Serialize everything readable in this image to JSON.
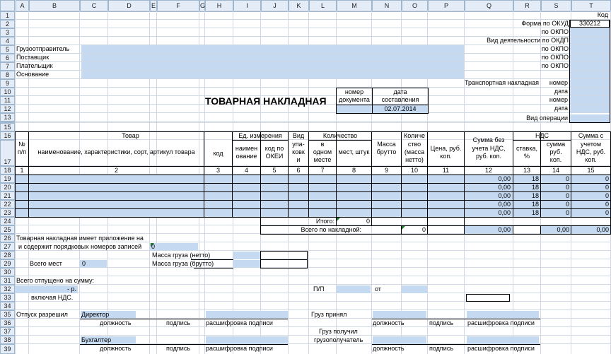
{
  "columns": [
    "A",
    "B",
    "C",
    "D",
    "E",
    "F",
    "G",
    "H",
    "I",
    "J",
    "K",
    "L",
    "M",
    "N",
    "O",
    "P",
    "Q",
    "R",
    "S",
    "T"
  ],
  "rows": [
    "1",
    "2",
    "3",
    "4",
    "5",
    "6",
    "7",
    "8",
    "9",
    "10",
    "11",
    "12",
    "13",
    "14",
    "15",
    "16",
    "17",
    "18",
    "19",
    "20",
    "21",
    "22",
    "23",
    "24",
    "25",
    "26",
    "27",
    "28",
    "29",
    "30",
    "31",
    "32",
    "33",
    "34",
    "35",
    "36",
    "37",
    "38",
    "39"
  ],
  "header": {
    "kod": "Код",
    "okud_label": "Форма по ОКУД",
    "okud_value": "330212",
    "okpo": "по ОКПО",
    "vid_deyat": "Вид деятельности по ОКДП",
    "gruzootpravitel": "Грузоотправитель",
    "postavshik": "Поставщик",
    "platelshik": "Плательщик",
    "osnovanie": "Основание",
    "transport": "Транспортная накладная",
    "nomer": "номер",
    "data": "дата",
    "vid_operacii": "Вид операции",
    "title": "ТОВАРНАЯ НАКЛАДНАЯ",
    "nomer_doc_1": "номер",
    "nomer_doc_2": "документа",
    "data_sost_1": "дата",
    "data_sost_2": "составления",
    "date_value": "02.07.2014"
  },
  "table_head": {
    "np_1": "№",
    "np_2": "п/п",
    "tovar": "Товар",
    "naimen": "наименование, характеристики, сорт, артикул товара",
    "kod": "код",
    "ed_izm": "Ед. измерения",
    "naimen_1": "наимен",
    "naimen_2": "ование",
    "okei_1": "код по",
    "okei_2": "ОКЕИ",
    "vid_1": "Вид",
    "vid_2": "упа-",
    "vid_3": "ковк",
    "vid_4": "и",
    "kolichestvo": "Количество",
    "v_odnom_1": "в",
    "v_odnom_2": "одном",
    "v_odnom_3": "месте",
    "mest": "мест, штук",
    "massa_1": "Масса",
    "massa_2": "брутто",
    "kol_1": "Количе",
    "kol_2": "ство",
    "kol_3": "(масса",
    "kol_4": "нетто)",
    "cena_1": "Цена, руб.",
    "cena_2": "коп.",
    "summa_bez_1": "Сумма без",
    "summa_bez_2": "учета НДС,",
    "summa_bez_3": "руб. коп.",
    "nds": "НДС",
    "stavka_1": "ставка,",
    "stavka_2": "%",
    "summa_1": "сумма",
    "summa_2": "руб.",
    "summa_3": "коп.",
    "summa_s_1": "Сумма с",
    "summa_s_2": "учетом",
    "summa_s_3": "НДС, руб.",
    "summa_s_4": "коп.",
    "nums": [
      "1",
      "2",
      "3",
      "4",
      "5",
      "6",
      "7",
      "8",
      "9",
      "10",
      "11",
      "12",
      "13",
      "14",
      "15"
    ]
  },
  "data_rows": [
    {
      "sum": "0,00",
      "rate": "18",
      "vat": "0",
      "total": "0"
    },
    {
      "sum": "0,00",
      "rate": "18",
      "vat": "0",
      "total": "0"
    },
    {
      "sum": "0,00",
      "rate": "18",
      "vat": "0",
      "total": "0"
    },
    {
      "sum": "0,00",
      "rate": "18",
      "vat": "0",
      "total": "0"
    },
    {
      "sum": "0,00",
      "rate": "18",
      "vat": "0",
      "total": "0"
    }
  ],
  "totals": {
    "itogo": "Итого:",
    "itogo_val": "0",
    "vsego": "Всего по накладной:",
    "vsego_val": "0",
    "sum1": "0,00",
    "sum2": "0,00",
    "sum3": "0,00"
  },
  "footer": {
    "prilozh_1": "Товарная накладная имеет приложение на",
    "prilozh_2": "и содержит  порядковых номеров записей",
    "prilozh_val": "0",
    "massa_netto": "Масса груза (нетто)",
    "massa_brutto": "Масса груза (брутто)",
    "vsego_mest": "Всего мест",
    "vsego_mest_val": "0",
    "otpusheno": "Всего отпущено на сумму:",
    "rub": "-  р.",
    "vkl_nds": "включая НДС.",
    "pp": "П/П",
    "ot": "от",
    "otpusk": "Отпуск разрешил",
    "direktor": "Директор",
    "dolzhnost": "должность",
    "podpis": "подпись",
    "rasshifrovka": "расшифровка подписи",
    "gruz_prinyal": "Груз принял",
    "buhgalter": "Бухгалтер",
    "gruz_poluchil_1": "Груз получил",
    "gruz_poluchil_2": "грузополучатель"
  }
}
